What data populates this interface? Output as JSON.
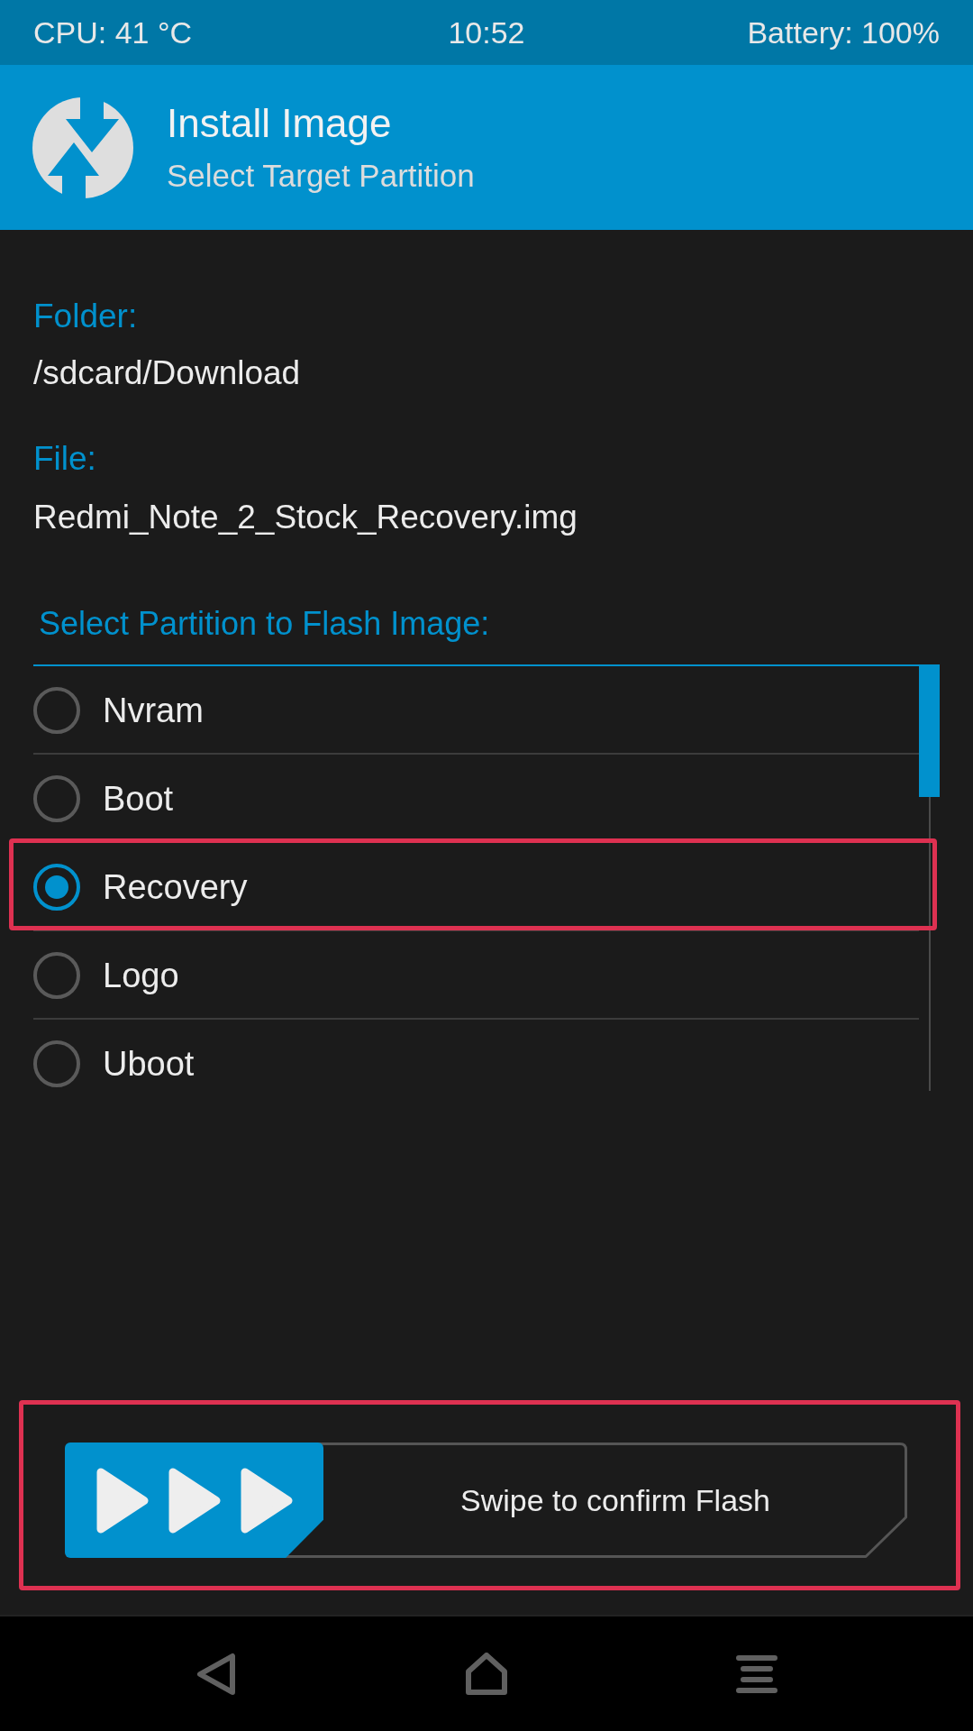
{
  "status_bar": {
    "cpu": "CPU: 41 °C",
    "time": "10:52",
    "battery": "Battery: 100%"
  },
  "header": {
    "title": "Install Image",
    "subtitle": "Select Target Partition"
  },
  "folder": {
    "label": "Folder:",
    "value": "/sdcard/Download"
  },
  "file": {
    "label": "File:",
    "value": "Redmi_Note_2_Stock_Recovery.img"
  },
  "partitions": {
    "heading": "Select Partition to Flash Image:",
    "items": [
      {
        "label": "Nvram",
        "selected": false,
        "highlighted": false
      },
      {
        "label": "Boot",
        "selected": false,
        "highlighted": false
      },
      {
        "label": "Recovery",
        "selected": true,
        "highlighted": true
      },
      {
        "label": "Logo",
        "selected": false,
        "highlighted": false
      },
      {
        "label": "Uboot",
        "selected": false,
        "highlighted": false
      }
    ]
  },
  "swipe": {
    "label": "Swipe to confirm Flash",
    "highlighted": true
  }
}
